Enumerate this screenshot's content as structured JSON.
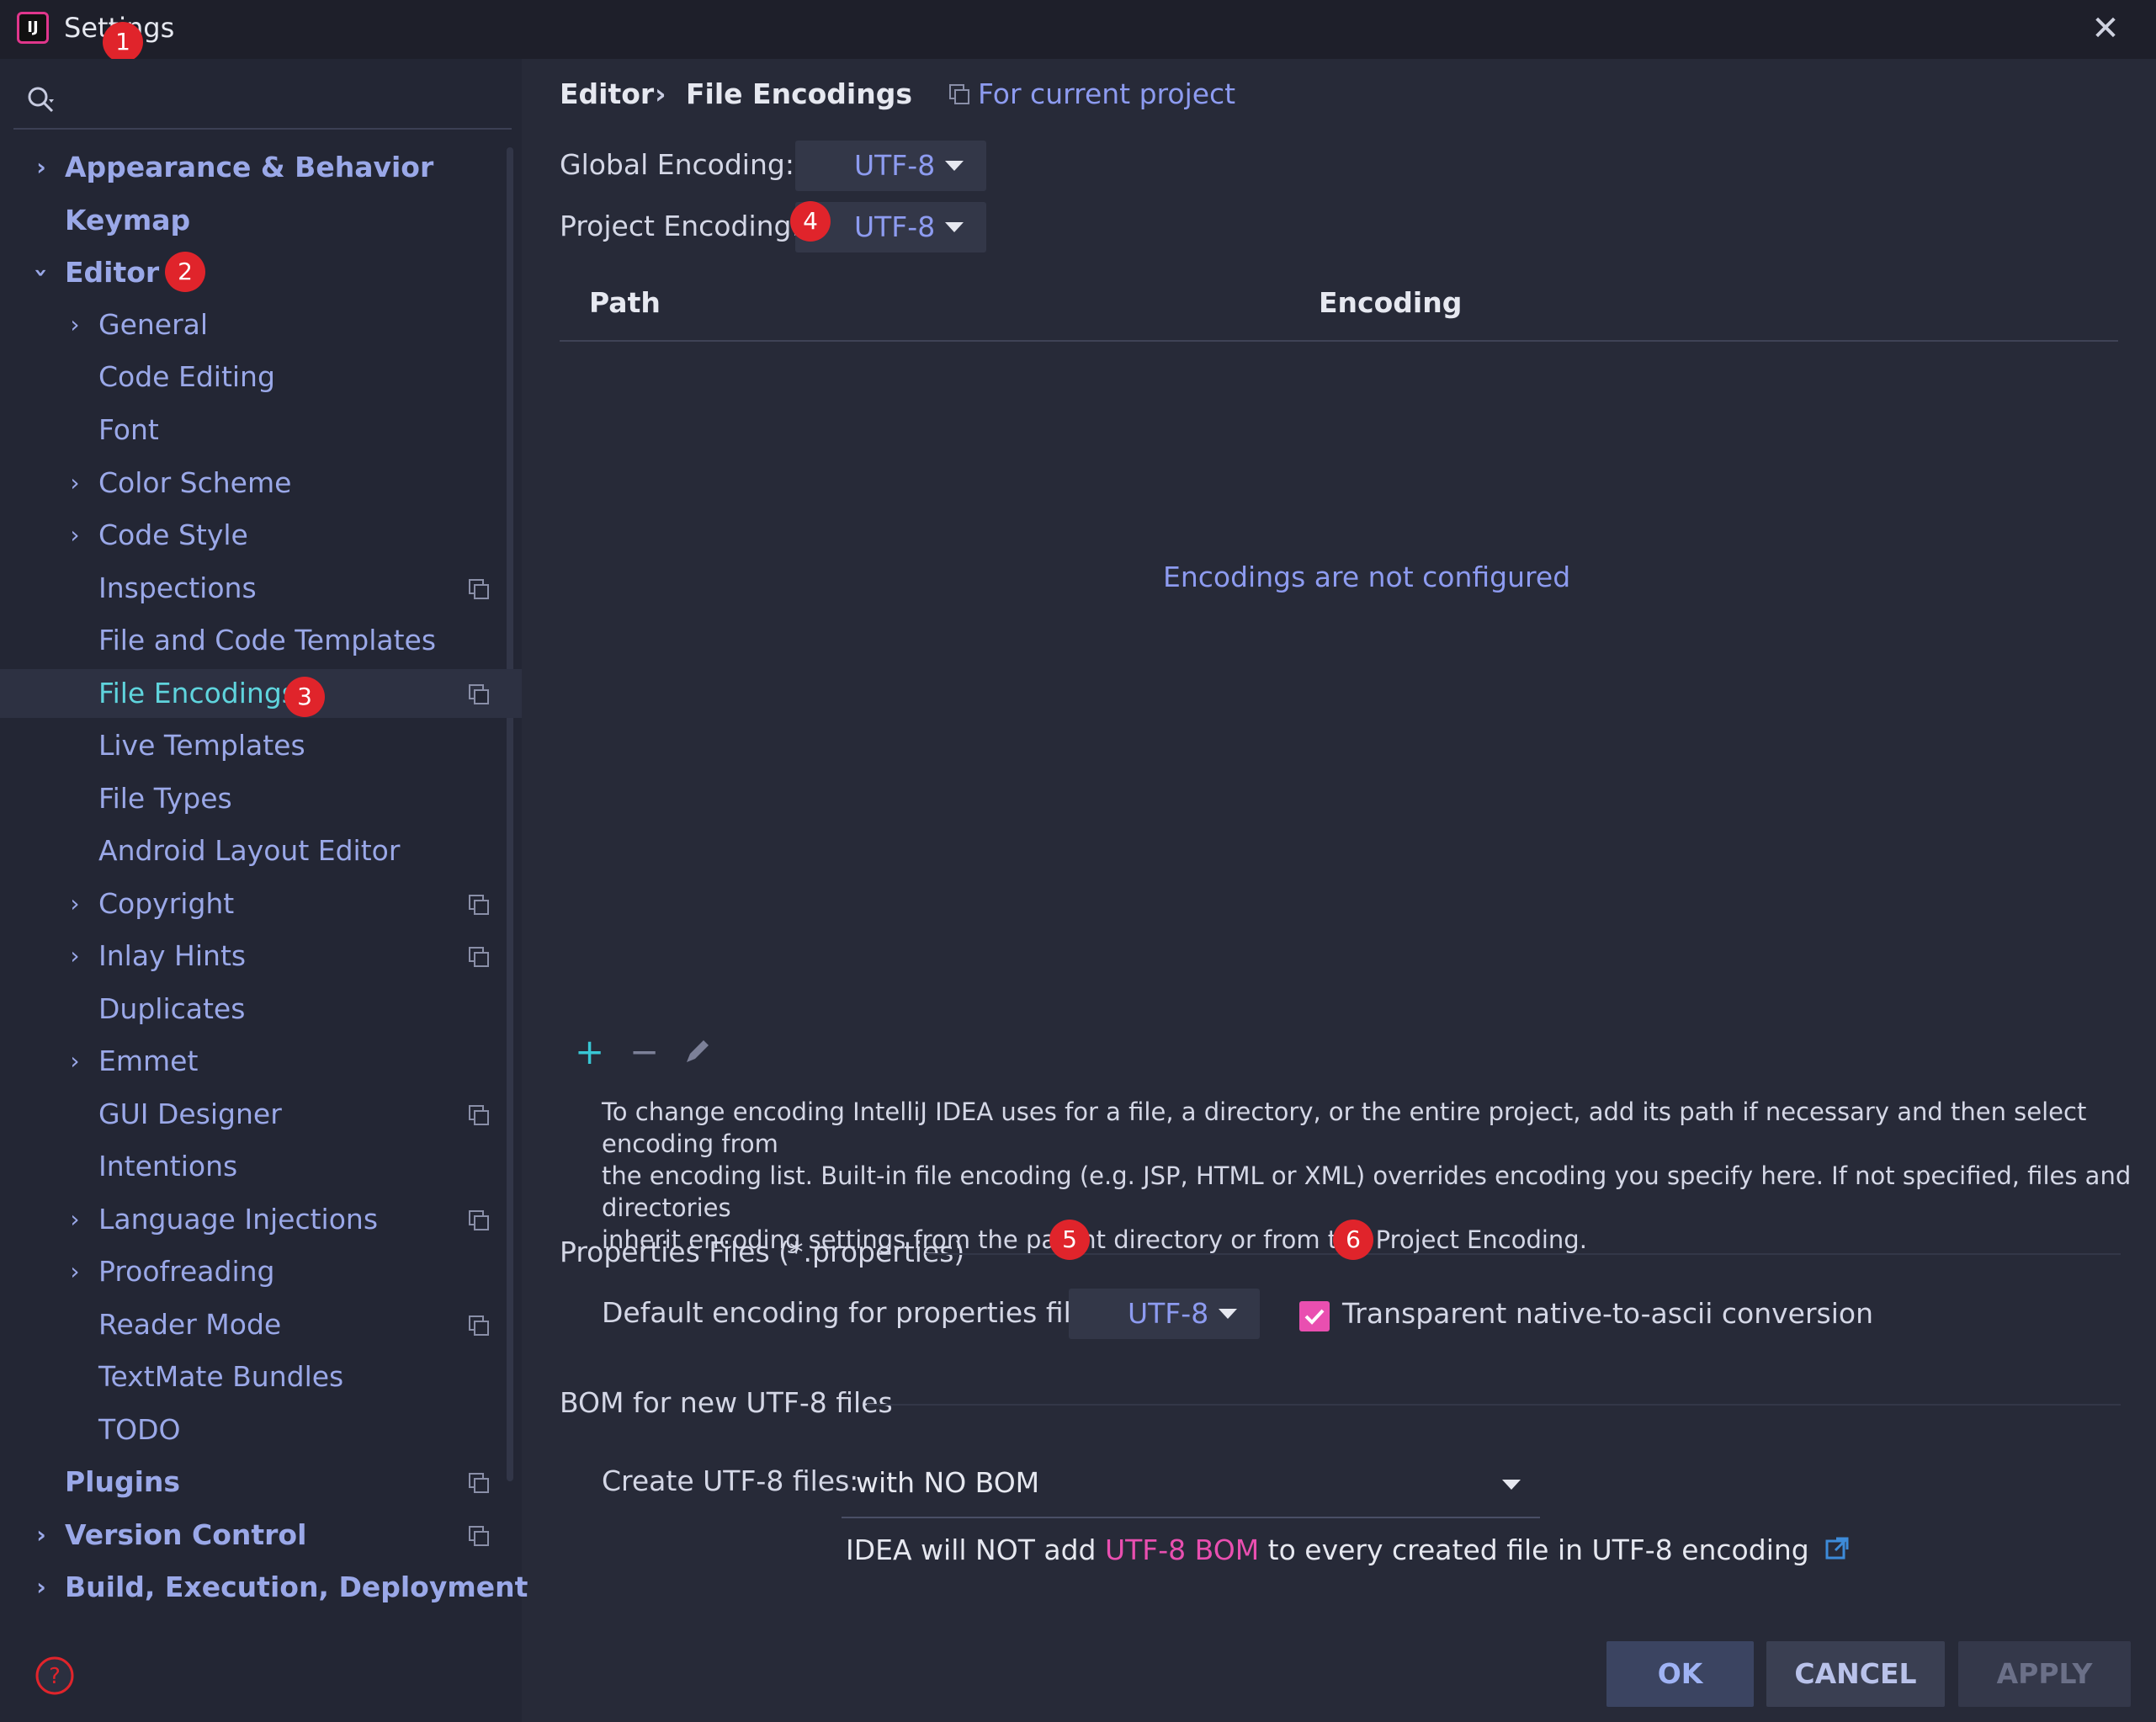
{
  "window": {
    "title": "Settings",
    "app_icon": "intellij-icon",
    "close_glyph": "✕"
  },
  "sidebar": {
    "items": [
      {
        "label": "Appearance & Behavior"
      },
      {
        "label": "Keymap"
      },
      {
        "label": "Editor"
      },
      {
        "label": "General"
      },
      {
        "label": "Code Editing"
      },
      {
        "label": "Font"
      },
      {
        "label": "Color Scheme"
      },
      {
        "label": "Code Style"
      },
      {
        "label": "Inspections"
      },
      {
        "label": "File and Code Templates"
      },
      {
        "label": "File Encodings"
      },
      {
        "label": "Live Templates"
      },
      {
        "label": "File Types"
      },
      {
        "label": "Android Layout Editor"
      },
      {
        "label": "Copyright"
      },
      {
        "label": "Inlay Hints"
      },
      {
        "label": "Duplicates"
      },
      {
        "label": "Emmet"
      },
      {
        "label": "GUI Designer"
      },
      {
        "label": "Intentions"
      },
      {
        "label": "Language Injections"
      },
      {
        "label": "Proofreading"
      },
      {
        "label": "Reader Mode"
      },
      {
        "label": "TextMate Bundles"
      },
      {
        "label": "TODO"
      },
      {
        "label": "Plugins"
      },
      {
        "label": "Version Control"
      },
      {
        "label": "Build, Execution, Deployment"
      }
    ]
  },
  "breadcrumb": {
    "parent": "Editor",
    "separator": "›",
    "current": "File Encodings",
    "scope": "For current project"
  },
  "encoding": {
    "global_label": "Global Encoding:",
    "global_value": "UTF-8",
    "project_label": "Project Encoding:",
    "project_value": "UTF-8"
  },
  "table": {
    "columns": [
      "Path",
      "Encoding"
    ],
    "empty_text": "Encodings are not configured"
  },
  "toolbar": {
    "add": "+",
    "remove": "−"
  },
  "help_text": {
    "line1": "To change encoding IntelliJ IDEA uses for a file, a directory, or the entire project, add its path if necessary and then select encoding from",
    "line2": "the encoding list. Built-in file encoding (e.g. JSP, HTML or XML) overrides encoding you specify here. If not specified, files and directories",
    "line3": "inherit encoding settings from the parent directory or from the Project Encoding."
  },
  "properties": {
    "section_title": "Properties Files (*.properties)",
    "default_label": "Default encoding for properties files:",
    "default_value": "UTF-8",
    "native_to_ascii_label": "Transparent native-to-ascii conversion",
    "native_to_ascii_checked": true
  },
  "bom": {
    "section_title": "BOM for new UTF-8 files",
    "create_label": "Create UTF-8 files:",
    "create_value": "with NO BOM",
    "note_prefix": "IDEA will NOT add ",
    "note_highlight": "UTF-8 BOM",
    "note_suffix": " to every created file in UTF-8 encoding"
  },
  "buttons": {
    "ok": "OK",
    "cancel": "CANCEL",
    "apply": "APPLY"
  },
  "badges": [
    "1",
    "2",
    "3",
    "4",
    "5",
    "6"
  ],
  "colors": {
    "accent": "#8d9bf0",
    "highlight": "#e94fb0",
    "badge": "#e0242b",
    "checkbox": "#e94fb0",
    "selected_item": "#5fd4dd"
  }
}
